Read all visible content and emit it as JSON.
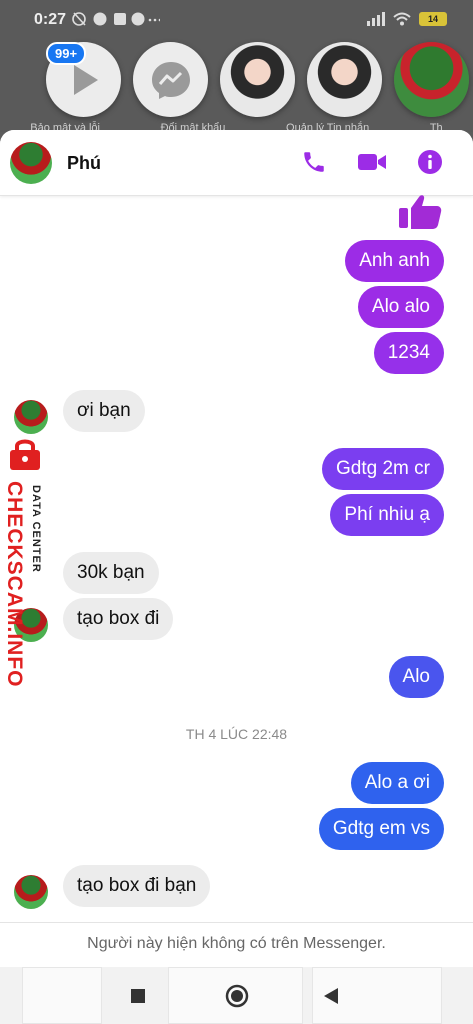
{
  "status_bar": {
    "time": "0:27",
    "battery": "14"
  },
  "chat_heads": {
    "badge": "99+",
    "items": [
      {
        "kind": "play-icon"
      },
      {
        "kind": "messenger-icon"
      },
      {
        "kind": "photo"
      },
      {
        "kind": "photo"
      },
      {
        "kind": "photo-green"
      }
    ]
  },
  "background_labels": [
    "Bảo mật và lỗi",
    "Đổi mật khẩu",
    "Quản lý Tin nhắn",
    "Th"
  ],
  "header": {
    "name": "Phú",
    "icons": [
      "phone-icon",
      "video-icon",
      "info-icon"
    ],
    "accent": "#9b27e8"
  },
  "messages": [
    {
      "dir": "out",
      "type": "like"
    },
    {
      "dir": "out",
      "text": "Anh anh"
    },
    {
      "dir": "out",
      "text": "Alo alo"
    },
    {
      "dir": "out",
      "text": "1234"
    },
    {
      "dir": "in",
      "text": "ơi bạn"
    },
    {
      "dir": "out",
      "text": "Gdtg 2m cr"
    },
    {
      "dir": "out",
      "text": "Phí nhiu ạ"
    },
    {
      "dir": "in",
      "text": "30k bạn"
    },
    {
      "dir": "in",
      "text": "tạo box đi"
    },
    {
      "dir": "out",
      "text": "Alo"
    },
    {
      "dir": "out",
      "text": "Alo a ơi"
    },
    {
      "dir": "out",
      "text": "Gdtg em vs"
    },
    {
      "dir": "in",
      "text": "tạo box đi bạn"
    }
  ],
  "timestamp": "TH 4 LÚC 22:48",
  "footer_note": "Người này hiện không có trên Messenger.",
  "watermark": {
    "main": "CHECKSCAM.INFO",
    "sub": "DATA CENTER"
  },
  "colors": {
    "purple": "#9c2ce6",
    "violet": "#7a3ef0",
    "blue": "#2f62ee"
  }
}
